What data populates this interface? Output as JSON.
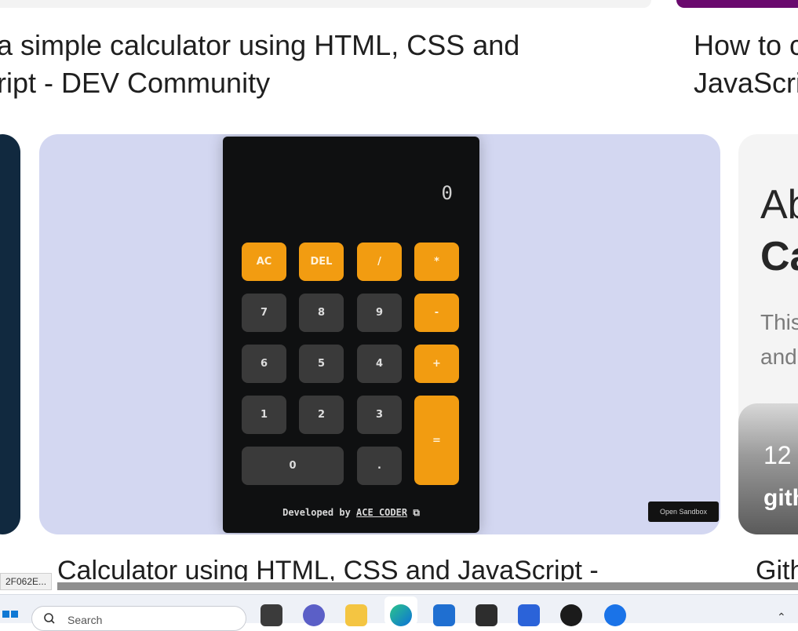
{
  "results": {
    "left_title_lines": [
      "a simple calculator using HTML, CSS and",
      "ript - DEV Community"
    ],
    "right_title_lines": [
      "How to c",
      "JavaScri"
    ],
    "main_caption": "Calculator using HTML, CSS and JavaScript -",
    "right_caption": "Gith"
  },
  "calculator": {
    "display": "0",
    "keys": [
      {
        "label": "AC",
        "type": "op"
      },
      {
        "label": "DEL",
        "type": "op"
      },
      {
        "label": "/",
        "type": "op"
      },
      {
        "label": "*",
        "type": "op"
      },
      {
        "label": "7",
        "type": "num"
      },
      {
        "label": "8",
        "type": "num"
      },
      {
        "label": "9",
        "type": "num"
      },
      {
        "label": "-",
        "type": "op"
      },
      {
        "label": "6",
        "type": "num"
      },
      {
        "label": "5",
        "type": "num"
      },
      {
        "label": "4",
        "type": "num"
      },
      {
        "label": "+",
        "type": "op"
      },
      {
        "label": "1",
        "type": "num"
      },
      {
        "label": "2",
        "type": "num"
      },
      {
        "label": "3",
        "type": "num"
      },
      {
        "label": "=",
        "type": "op"
      },
      {
        "label": "0",
        "type": "num"
      },
      {
        "label": ".",
        "type": "num"
      }
    ],
    "footer_prefix": "Developed by",
    "footer_author": "ACE CODER",
    "footer_icon": "external-link-icon",
    "sandbox_label": "Open Sandbox"
  },
  "right_card": {
    "heading_1": "Ab",
    "heading_2": "Ca",
    "body_1": "This",
    "body_2": "and",
    "stat": "12",
    "source": "gith"
  },
  "status_tooltip": "2F062E...",
  "taskbar": {
    "search_placeholder": "Search",
    "icons": [
      "windows-start-icon",
      "search-icon",
      "task-view-icon",
      "teams-icon",
      "file-explorer-icon",
      "edge-icon",
      "store-icon",
      "app-icon",
      "app-icon",
      "xbox-icon",
      "chrome-icon"
    ]
  },
  "colors": {
    "accent_orange": "#f29c11",
    "calc_bg": "#0f1011",
    "card_bg": "#d3d7f1",
    "dark_key": "#3a3a3a"
  }
}
